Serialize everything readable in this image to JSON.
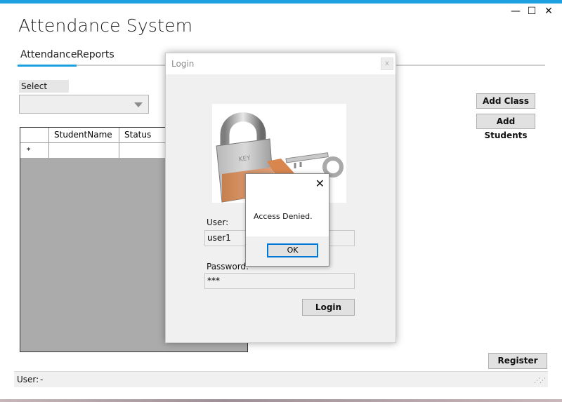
{
  "window": {
    "title": "Attendance System",
    "controls": {
      "minimize": "—",
      "maximize": "☐",
      "close": "✕"
    }
  },
  "tabs": [
    {
      "label": "Attendance",
      "selected": true
    },
    {
      "label": "Reports",
      "selected": false
    }
  ],
  "class_selector": {
    "label": "Select Class:",
    "value": ""
  },
  "buttons": {
    "add_class": "Add Class",
    "add_students": "Add Students",
    "register": "Register"
  },
  "grid": {
    "columns": [
      "StudentName",
      "Status"
    ],
    "new_row_marker": "*"
  },
  "statusbar": {
    "user_label": "User:",
    "user_value": "-"
  },
  "login_dialog": {
    "title": "Login",
    "close": "x",
    "user_label": "User:",
    "user_value": "user1",
    "password_label": "Password:",
    "password_value": "***",
    "login_button": "Login"
  },
  "message_box": {
    "close": "✕",
    "text": "Access Denied.",
    "ok_button": "OK"
  },
  "colors": {
    "accent": "#1ba1e2",
    "grid_bg": "#ababab",
    "focus": "#0078d7"
  }
}
